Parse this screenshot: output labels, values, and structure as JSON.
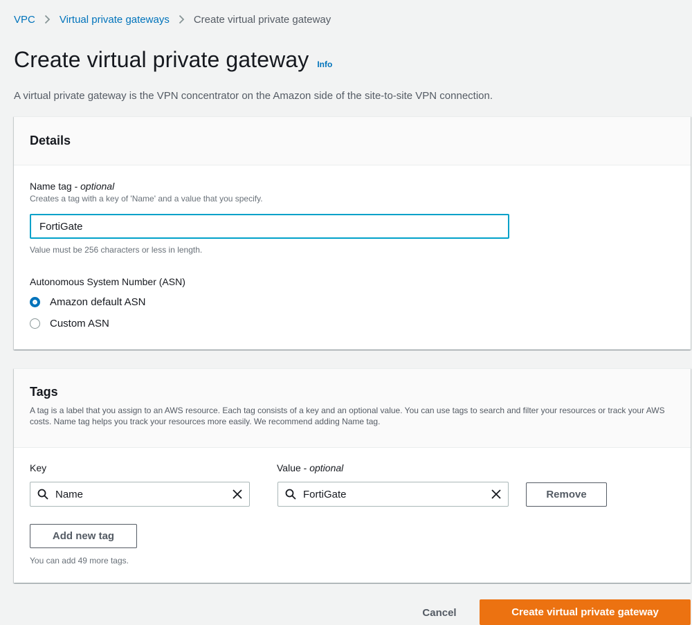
{
  "breadcrumb": {
    "items": [
      "VPC",
      "Virtual private gateways"
    ],
    "current": "Create virtual private gateway"
  },
  "header": {
    "title": "Create virtual private gateway",
    "info_link": "Info",
    "description": "A virtual private gateway is the VPN concentrator on the Amazon side of the site-to-site VPN connection."
  },
  "details": {
    "title": "Details",
    "name_tag_label": "Name tag - ",
    "name_tag_optional": "optional",
    "name_tag_desc": "Creates a tag with a key of 'Name' and a value that you specify.",
    "name_tag_value": "FortiGate",
    "name_tag_constraint": "Value must be 256 characters or less in length.",
    "asn_label": "Autonomous System Number (ASN)",
    "asn_options": [
      {
        "label": "Amazon default ASN",
        "selected": true
      },
      {
        "label": "Custom ASN",
        "selected": false
      }
    ]
  },
  "tags": {
    "title": "Tags",
    "description": "A tag is a label that you assign to an AWS resource. Each tag consists of a key and an optional value. You can use tags to search and filter your resources or track your AWS costs. Name tag helps you track your resources more easily. We recommend adding Name tag.",
    "key_label": "Key",
    "value_label": "Value - ",
    "value_optional": "optional",
    "rows": [
      {
        "key": "Name",
        "value": "FortiGate"
      }
    ],
    "remove_label": "Remove",
    "add_label": "Add new tag",
    "limit_text": "You can add 49 more tags."
  },
  "actions": {
    "cancel_label": "Cancel",
    "create_label": "Create virtual private gateway"
  },
  "colors": {
    "link": "#0073bb",
    "primary_button": "#ec7211",
    "focus_border": "#00a1c9",
    "page_background": "#f2f3f3"
  },
  "icons": [
    "chevron-right-icon",
    "search-icon",
    "clear-icon"
  ]
}
